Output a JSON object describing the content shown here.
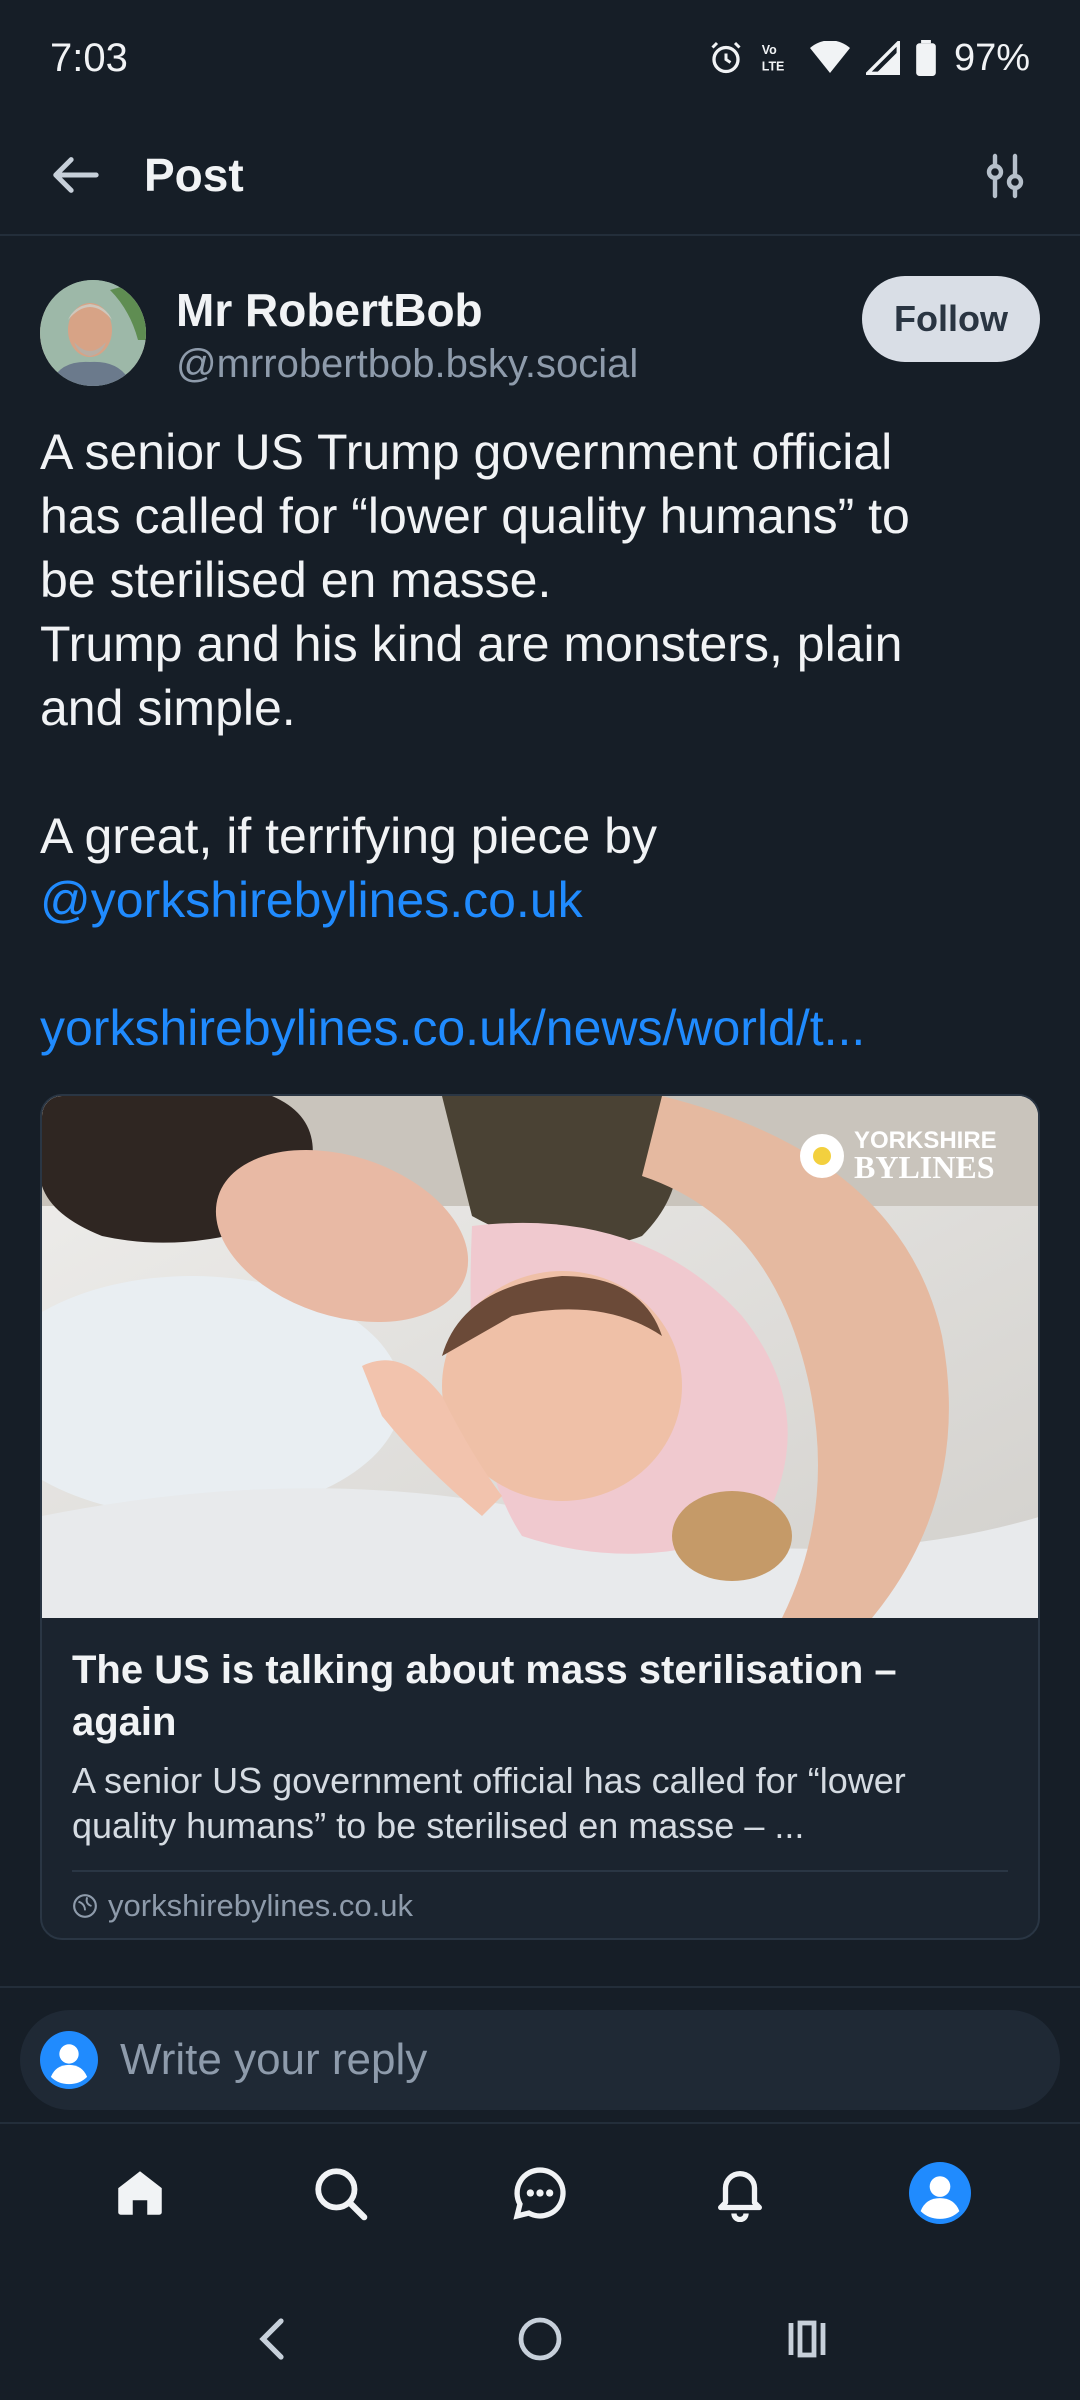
{
  "status_bar": {
    "time": "7:03",
    "battery": "97%",
    "icons": [
      "alarm-icon",
      "volte-icon",
      "wifi-icon",
      "signal-icon",
      "battery-icon"
    ]
  },
  "header": {
    "title": "Post",
    "back_icon": "arrow-left-icon",
    "filter_icon": "sliders-icon"
  },
  "post": {
    "author_name": "Mr RobertBob",
    "author_handle": "@mrrobertbob.bsky.social",
    "follow_label": "Follow",
    "text_lines": [
      "A senior US Trump government official",
      "has called for “lower quality humans” to",
      "be sterilised en masse.",
      "Trump and his kind are monsters, plain",
      "and simple.",
      "",
      "A great, if terrifying piece by"
    ],
    "mention": "@yorkshirebylines.co.uk",
    "url_text": "yorkshirebylines.co.uk/news/world/t..."
  },
  "link_card": {
    "image_watermark_line1": "YORKSHIRE",
    "image_watermark_line2": "BYLINES",
    "title": "The US is talking about mass sterilisation – again",
    "description": "A senior US government official has called for “lower quality humans” to be sterilised en masse – ...",
    "source": "yorkshirebylines.co.uk"
  },
  "reply": {
    "placeholder": "Write your reply"
  },
  "bottom_nav": {
    "items": [
      "home-icon",
      "search-icon",
      "chat-icon",
      "bell-icon",
      "profile-icon"
    ]
  },
  "colors": {
    "background": "#161e27",
    "link": "#208bfe",
    "muted": "#8e9bab",
    "follow_bg": "#d9dee6"
  }
}
